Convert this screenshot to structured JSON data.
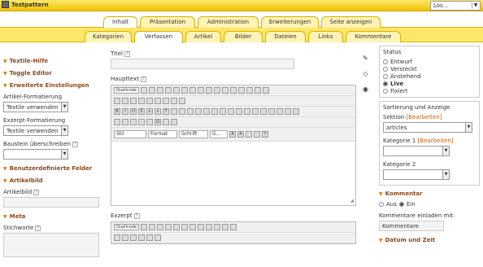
{
  "app": {
    "name": "Testpattern",
    "go_menu": "Los..."
  },
  "primary_tabs": [
    "Inhalt",
    "Präsentation",
    "Administration",
    "Erweiterungen",
    "Seite anzeigen"
  ],
  "secondary_tabs": [
    "Kategorien",
    "Verfassen",
    "Artikel",
    "Bilder",
    "Dateien",
    "Links",
    "Kommentare"
  ],
  "left": {
    "textile_help": "Textile-Hilfe",
    "toggle_editor": "Toggle Editor",
    "advanced": "Erweiterte Einstellungen",
    "article_format_label": "Artikel-Formatierung",
    "article_format_value": "Textile verwenden",
    "excerpt_format_label": "Exzerpt-Formatierung",
    "excerpt_format_value": "Textile verwenden",
    "override_label": "Baustein überschreiben",
    "custom_fields": "Benutzerdefinierte Felder",
    "article_image_section": "Artikelbild",
    "article_image_label": "Artikelbild",
    "meta": "Meta",
    "keywords_label": "Stichworte"
  },
  "main": {
    "title_label": "Titel",
    "body_label": "Haupttext",
    "excerpt_label": "Exzerpt",
    "source_label": "Quellcode",
    "style_label": "Stil",
    "format_label": "Format",
    "font_label": "Schrift",
    "size_label": "G...",
    "help_mark": "?"
  },
  "right": {
    "status_title": "Status",
    "status_options": [
      "Entwurf",
      "Versteckt",
      "Anstehend",
      "Live",
      "Fixiert"
    ],
    "status_selected": "Live",
    "sort_title": "Sortierung und Anzeige",
    "section_label": "Sektion",
    "edit_link": "[Bearbeiten]",
    "section_value": "articles",
    "cat1_label": "Kategorie 1",
    "cat2_label": "Kategorie 2",
    "comments_title": "Kommentar",
    "comments_off": "Aus",
    "comments_on": "Ein",
    "comments_selected": "Ein",
    "invite_label": "Kommentare einladen mit:",
    "invite_value": "Kommentare",
    "datetime_title": "Datum und Zeit"
  },
  "colors": {
    "accent": "#f2c200",
    "heading": "#8a4b1f",
    "link": "#d25f00"
  }
}
